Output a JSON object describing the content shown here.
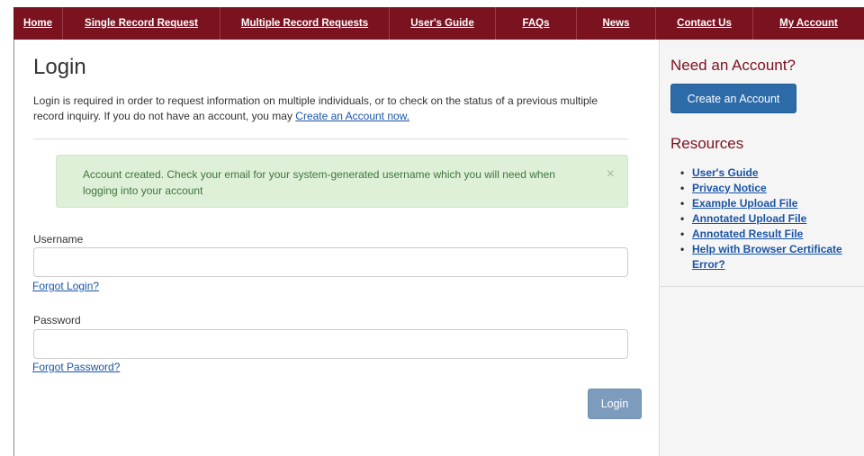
{
  "nav": {
    "items": [
      {
        "label": "Home"
      },
      {
        "label": "Single Record Request"
      },
      {
        "label": "Multiple Record Requests"
      },
      {
        "label": "User's Guide"
      },
      {
        "label": "FAQs"
      },
      {
        "label": "News"
      },
      {
        "label": "Contact Us"
      },
      {
        "label": "My Account"
      }
    ]
  },
  "main": {
    "title": "Login",
    "intro_text": "Login is required in order to request information on multiple individuals, or to check on the status of a previous multiple record inquiry. If you do not have an account, you may ",
    "intro_link": "Create an Account now.",
    "alert": {
      "text": "Account created. Check your email for your system-generated username which you will need when logging into your account",
      "close_glyph": "×"
    },
    "username": {
      "label": "Username",
      "value": "",
      "placeholder": ""
    },
    "forgot_login": "Forgot Login?",
    "password": {
      "label": "Password",
      "value": "",
      "placeholder": ""
    },
    "forgot_password": "Forgot Password?",
    "login_button": "Login"
  },
  "sidebar": {
    "account_heading": "Need an Account?",
    "create_button": "Create an Account",
    "resources_heading": "Resources",
    "resources": [
      {
        "label": "User's Guide"
      },
      {
        "label": "Privacy Notice"
      },
      {
        "label": "Example Upload File"
      },
      {
        "label": "Annotated Upload File"
      },
      {
        "label": "Annotated Result File"
      },
      {
        "label": "Help with Browser Certificate Error?"
      }
    ]
  },
  "colors": {
    "nav_bg": "#7a1220",
    "heading_accent": "#7a1220",
    "alert_bg": "#dff0d8",
    "alert_text": "#3c763d",
    "primary_button": "#2c6aa8",
    "login_button": "#7d9bbd",
    "link": "#1a54a6"
  }
}
